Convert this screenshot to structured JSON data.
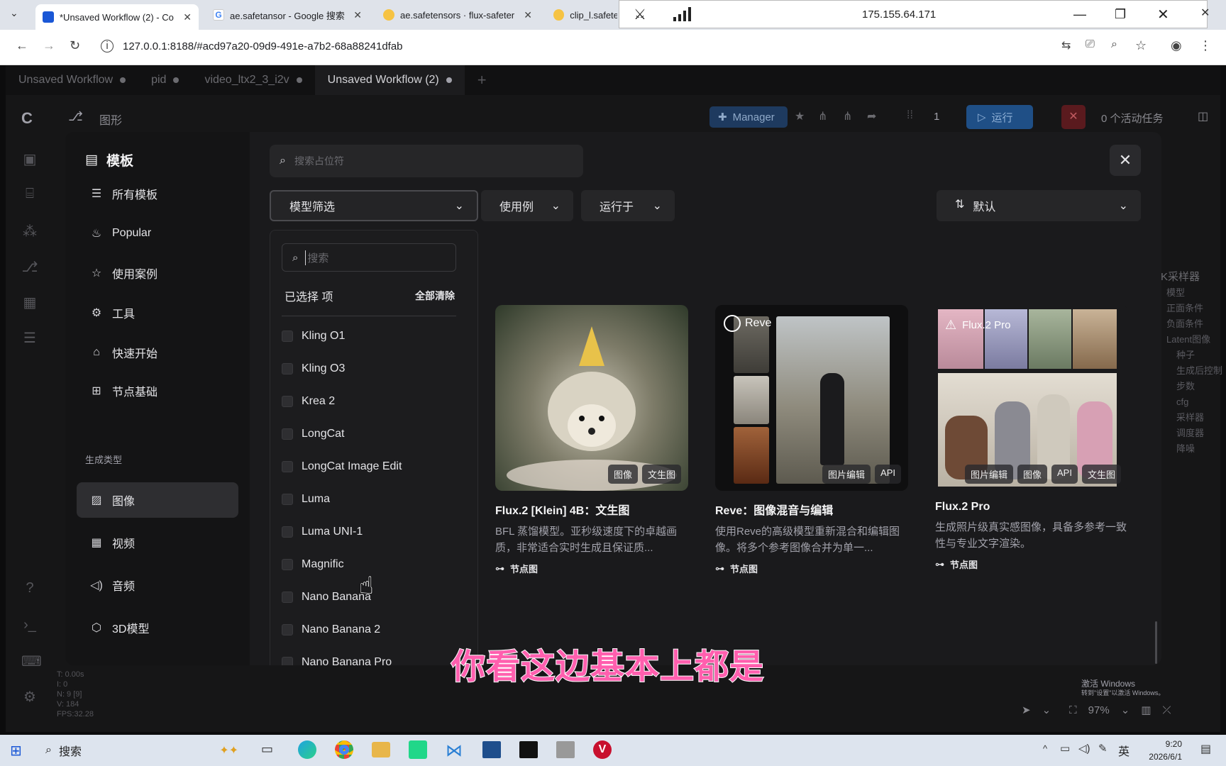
{
  "browser": {
    "tabs": [
      {
        "title": "*Unsaved Workflow (2) - Co",
        "active": true
      },
      {
        "title": "ae.safetansor - Google 搜索"
      },
      {
        "title": "ae.safetensors · flux-safeter"
      },
      {
        "title": "clip_l.safete"
      }
    ],
    "url": "127.0.0.1:8188/#acd97a20-09d9-491e-a7b2-68a88241dfab",
    "remote_ip": "175.155.64.171"
  },
  "workflow_tabs": [
    {
      "label": "Unsaved Workflow"
    },
    {
      "label": "pid"
    },
    {
      "label": "video_ltx2_3_i2v"
    },
    {
      "label": "Unsaved Workflow (2)",
      "active": true
    }
  ],
  "toolbar": {
    "graph_label": "图形",
    "manager_label": "Manager",
    "queue_count": "1",
    "run_label": "运行",
    "active_tasks": "0 个活动任务"
  },
  "sidebar": {
    "title": "模板",
    "items": [
      {
        "label": "所有模板",
        "icon": "list-icon"
      },
      {
        "label": "Popular",
        "icon": "flame-icon"
      },
      {
        "label": "使用案例",
        "icon": "star-icon"
      },
      {
        "label": "工具",
        "icon": "gear-icon"
      },
      {
        "label": "快速开始",
        "icon": "graduation-cap-icon"
      },
      {
        "label": "节点基础",
        "icon": "blocks-icon"
      }
    ],
    "section_label": "生成类型",
    "gen_types": [
      {
        "label": "图像",
        "icon": "image-icon",
        "selected": true
      },
      {
        "label": "视频",
        "icon": "film-icon"
      },
      {
        "label": "音频",
        "icon": "speaker-icon"
      },
      {
        "label": "3D模型",
        "icon": "cube-icon"
      }
    ]
  },
  "search": {
    "placeholder": "搜索占位符"
  },
  "filters": {
    "model": "模型筛选",
    "usecase": "使用例",
    "runs_on": "运行于",
    "sort": "默认"
  },
  "dropdown": {
    "search_placeholder": "搜索",
    "selected_label": "已选择 项",
    "clear_all": "全部清除",
    "options": [
      "Kling O1",
      "Kling O3",
      "Krea 2",
      "LongCat",
      "LongCat Image Edit",
      "Luma",
      "Luma UNI-1",
      "Magnific",
      "Nano Banana",
      "Nano Banana 2",
      "Nano Banana Pro"
    ]
  },
  "cards": [
    {
      "title": "Flux.2 [Klein] 4B：文生图",
      "desc": "BFL 蒸馏模型。亚秒级速度下的卓越画质，非常适合实时生成且保证质...",
      "tags": [
        "图像",
        "文生图"
      ],
      "foot": "节点图"
    },
    {
      "title": "Reve：图像混音与编辑",
      "desc": "使用Reve的高级模型重新混合和编辑图像。将多个参考图像合并为单一...",
      "tags": [
        "图片编辑",
        "API"
      ],
      "badge": "Reve",
      "foot": "节点图"
    },
    {
      "title": "Flux.2 Pro",
      "desc": "生成照片级真实感图像，具备多参考一致性与专业文字渲染。",
      "tags": [
        "图片编辑",
        "图像",
        "API",
        "文生图"
      ],
      "badge": "Flux.2 Pro",
      "foot": "节点图"
    }
  ],
  "right_panel": {
    "title": "K采样器",
    "items": [
      "模型",
      "正面条件",
      "负面条件",
      "Latent图像",
      "种子",
      "生成后控制",
      "步数",
      "cfg",
      "采样器",
      "调度器",
      "降噪"
    ]
  },
  "status": {
    "lines": [
      "T: 0.00s",
      "I: 0",
      "N: 9 [9]",
      "V: 184",
      "FPS:32.28"
    ],
    "zoom": "97%"
  },
  "watermark": {
    "line1": "激活 Windows",
    "line2": "转到\"设置\"以激活 Windows。"
  },
  "subtitle": "你看这边基本上都是",
  "taskbar": {
    "search_label": "搜索",
    "ime": "英",
    "time": "9:20",
    "date": "2026/6/1"
  }
}
